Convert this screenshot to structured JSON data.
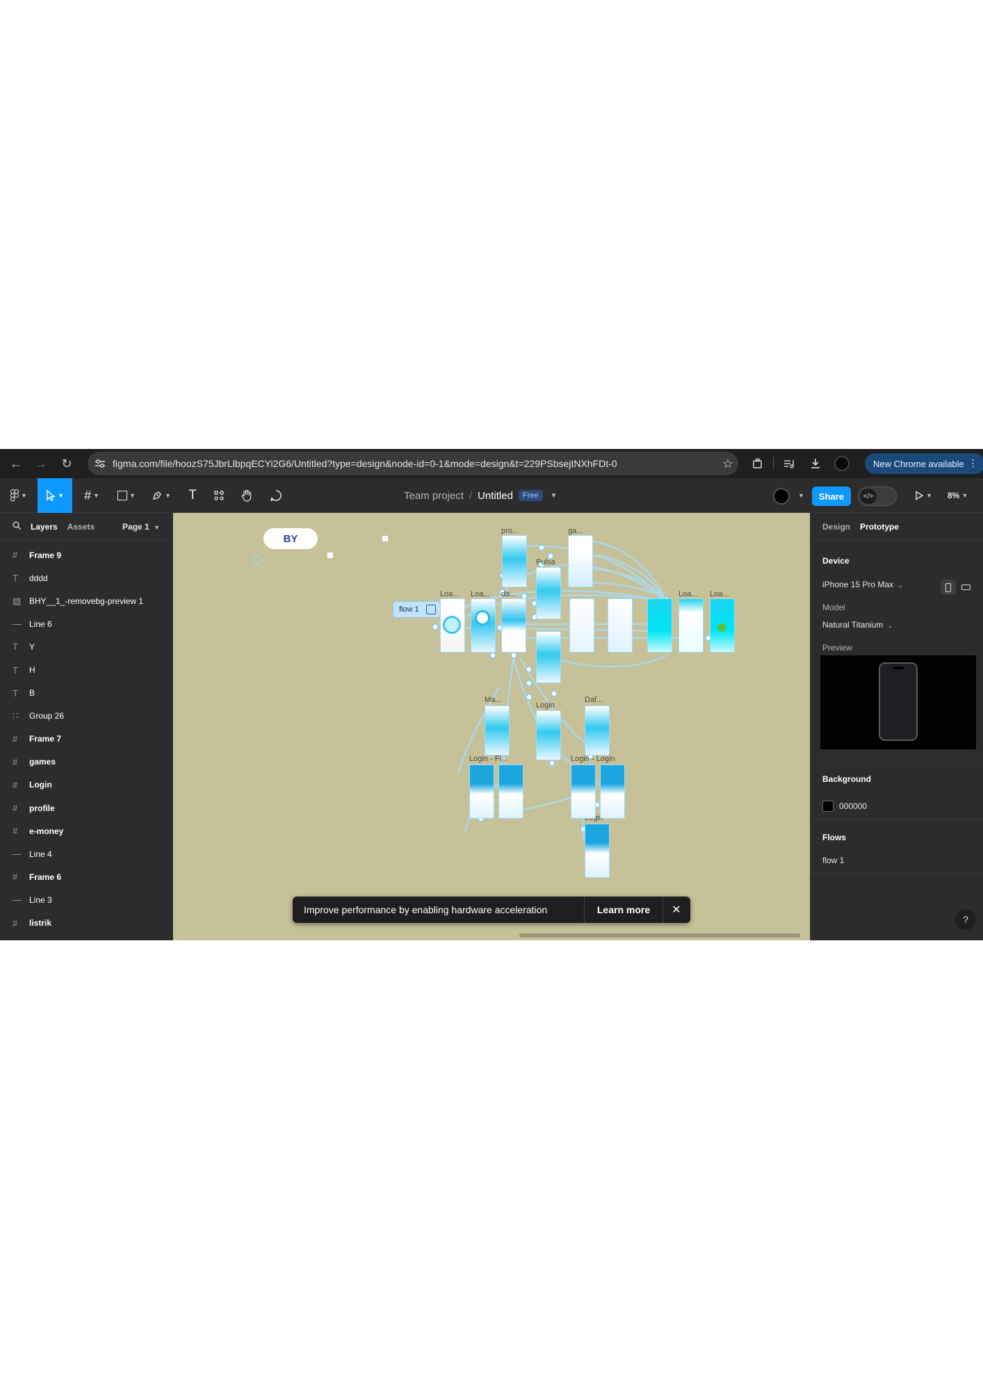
{
  "browser": {
    "url": "figma.com/file/hoozS75JbrLlbpqECYi2G6/Untitled?type=design&node-id=0-1&mode=design&t=229PSbsejtNXhFDt-0",
    "update_label": "New Chrome available"
  },
  "toolbar": {
    "team": "Team project",
    "slash": "/",
    "file": "Untitled",
    "badge": "Free",
    "share_label": "Share",
    "zoom": "8%"
  },
  "left_panel": {
    "tabs": [
      "Layers",
      "Assets"
    ],
    "page": "Page 1",
    "layers": [
      {
        "icon": "frame",
        "name": "Frame 9",
        "bold": true
      },
      {
        "icon": "text",
        "name": "dddd",
        "bold": false
      },
      {
        "icon": "image",
        "name": "BHY__1_-removebg-preview 1",
        "bold": false
      },
      {
        "icon": "line",
        "name": "Line 6",
        "bold": false
      },
      {
        "icon": "text",
        "name": "Y",
        "bold": false
      },
      {
        "icon": "text",
        "name": "H",
        "bold": false
      },
      {
        "icon": "text",
        "name": "B",
        "bold": false
      },
      {
        "icon": "group",
        "name": "Group 26",
        "bold": false
      },
      {
        "icon": "frame",
        "name": "Frame 7",
        "bold": true
      },
      {
        "icon": "frame",
        "name": "games",
        "bold": true
      },
      {
        "icon": "frame",
        "name": "Login",
        "bold": true
      },
      {
        "icon": "frame",
        "name": "profile",
        "bold": true
      },
      {
        "icon": "frame",
        "name": "e-money",
        "bold": true
      },
      {
        "icon": "line",
        "name": "Line 4",
        "bold": false
      },
      {
        "icon": "frame",
        "name": "Frame 6",
        "bold": true
      },
      {
        "icon": "line",
        "name": "Line 3",
        "bold": false
      },
      {
        "icon": "frame",
        "name": "listrik",
        "bold": true
      }
    ]
  },
  "canvas": {
    "flow_chip": "flow 1",
    "logo_text": "BY",
    "frame_labels": [
      "pro...",
      "ga...",
      "Pulsa",
      "Loa...",
      "Loa...",
      "da...",
      "Loa...",
      "Loa...",
      "Ma...",
      "Login",
      "Daf...",
      "Login - Fl...",
      "Login - Login",
      "Login"
    ],
    "toast": {
      "message": "Improve performance by enabling hardware acceleration",
      "action": "Learn more"
    }
  },
  "right_panel": {
    "tabs": [
      "Design",
      "Prototype"
    ],
    "device_title": "Device",
    "device": "iPhone 15 Pro Max",
    "model_label": "Model",
    "model": "Natural Titanium",
    "preview_label": "Preview",
    "background_title": "Background",
    "background_value": "000000",
    "flows_title": "Flows",
    "flow_item": "flow 1"
  },
  "colors": {
    "accent": "#0d99ff",
    "canvas": "#c7c19a",
    "panel": "#2c2c2c"
  }
}
